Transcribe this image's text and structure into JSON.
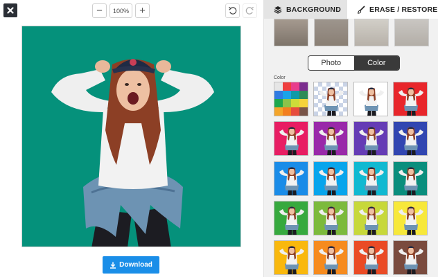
{
  "toolbar": {
    "zoom_value": "100%",
    "zoom_out_symbol": "−",
    "zoom_in_symbol": "+"
  },
  "icons": {
    "close": "close-icon",
    "undo": "undo-icon",
    "redo": "redo-icon",
    "download": "download-icon",
    "layers": "layers-icon",
    "brush": "brush-icon"
  },
  "canvas": {
    "background_color": "#05917b"
  },
  "download": {
    "label": "Download",
    "color": "#1a8ee8"
  },
  "panel": {
    "tabs": [
      {
        "label": "BACKGROUND",
        "active": true
      },
      {
        "label": "ERASE / RESTORE",
        "active": false
      }
    ],
    "mode_toggle": {
      "photo_label": "Photo",
      "color_label": "Color",
      "selected": "Color"
    },
    "color_section_label": "Color",
    "palette_colors": [
      "#e6e6e6",
      "#ef3e3e",
      "#e83e8c",
      "#7b2d8e",
      "#2f7be2",
      "#1aa3e8",
      "#0e9aa7",
      "#2e8b57",
      "#1da84c",
      "#8bc34a",
      "#cddc39",
      "#f5d33a",
      "#f4a52a",
      "#f37f1f",
      "#e74c3c",
      "#795548"
    ],
    "swatches": [
      {
        "kind": "palette"
      },
      {
        "kind": "transparent"
      },
      {
        "kind": "color",
        "color": "#ffffff"
      },
      {
        "kind": "color",
        "color": "#e8262b"
      },
      {
        "kind": "color",
        "color": "#e81d63"
      },
      {
        "kind": "color",
        "color": "#9929a9"
      },
      {
        "kind": "color",
        "color": "#653cb5"
      },
      {
        "kind": "color",
        "color": "#3146b1"
      },
      {
        "kind": "color",
        "color": "#1a8ce8"
      },
      {
        "kind": "color",
        "color": "#08a5ec"
      },
      {
        "kind": "color",
        "color": "#10b9d1"
      },
      {
        "kind": "color",
        "color": "#0a8e7d"
      },
      {
        "kind": "color",
        "color": "#36a93e"
      },
      {
        "kind": "color",
        "color": "#7cba3c"
      },
      {
        "kind": "color",
        "color": "#c7d83a"
      },
      {
        "kind": "color",
        "color": "#f7e83a"
      },
      {
        "kind": "color",
        "color": "#f9b80d"
      },
      {
        "kind": "color",
        "color": "#f68b1e"
      },
      {
        "kind": "color",
        "color": "#ea4b25"
      },
      {
        "kind": "color",
        "color": "#7a4b3e"
      }
    ]
  }
}
